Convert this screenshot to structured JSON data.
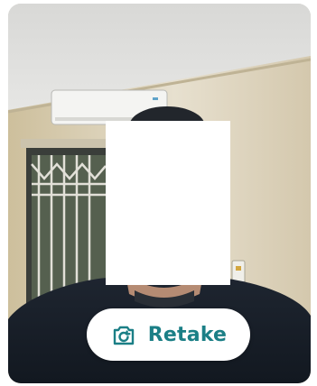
{
  "camera_preview": {
    "redacted": true
  },
  "retake_button": {
    "label": "Retake",
    "icon": "camera-rotate-icon"
  },
  "colors": {
    "accent": "#1b7f86",
    "button_background": "#ffffff"
  }
}
